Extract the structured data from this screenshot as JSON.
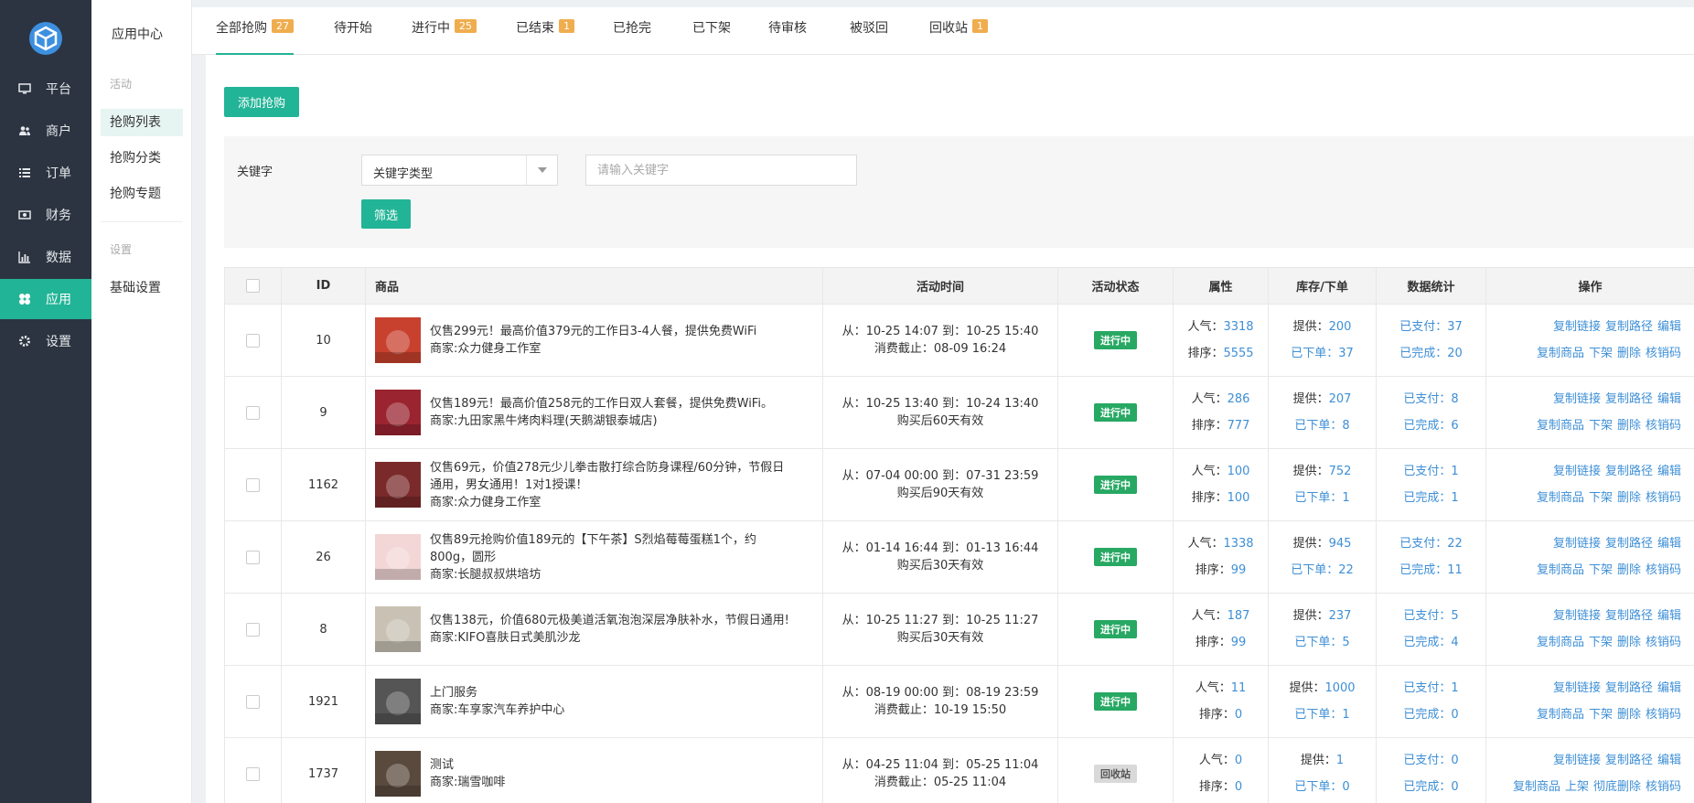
{
  "sidebar": {
    "items": [
      {
        "label": "平台",
        "icon": "monitor-icon"
      },
      {
        "label": "商户",
        "icon": "users-icon"
      },
      {
        "label": "订单",
        "icon": "list-icon"
      },
      {
        "label": "财务",
        "icon": "money-icon"
      },
      {
        "label": "数据",
        "icon": "bar-chart-icon"
      },
      {
        "label": "应用",
        "icon": "apps-icon"
      },
      {
        "label": "设置",
        "icon": "gear-icon"
      }
    ],
    "active": "应用"
  },
  "subnav": {
    "title": "应用中心",
    "section1": "活动",
    "items1": [
      "抢购列表",
      "抢购分类",
      "抢购专题"
    ],
    "section2": "设置",
    "items2": [
      "基础设置"
    ]
  },
  "tabs": [
    {
      "label": "全部抢购",
      "badge": "27"
    },
    {
      "label": "待开始",
      "badge": ""
    },
    {
      "label": "进行中",
      "badge": "25"
    },
    {
      "label": "已结束",
      "badge": "1"
    },
    {
      "label": "已抢完",
      "badge": ""
    },
    {
      "label": "已下架",
      "badge": ""
    },
    {
      "label": "待审核",
      "badge": ""
    },
    {
      "label": "被驳回",
      "badge": ""
    },
    {
      "label": "回收站",
      "badge": "1"
    }
  ],
  "toolbar": {
    "add_label": "添加抢购"
  },
  "filter": {
    "label": "关键字",
    "select_value": "关键字类型",
    "input_placeholder": "请输入关键字",
    "submit_label": "筛选"
  },
  "table": {
    "headers": [
      "ID",
      "商品",
      "活动时间",
      "活动状态",
      "属性",
      "库存/下单",
      "数据统计",
      "操作"
    ],
    "rows": [
      {
        "id": "10",
        "title": "仅售299元！最高价值379元的工作日3-4人餐，提供免费WiFi",
        "merchant": "商家:众力健身工作室",
        "time1": "从：10-25 14:07 到：10-25 15:40",
        "time2": "消费截止：08-09 16:24",
        "status": "进行中",
        "pop_label": "人气：",
        "pop": "3318",
        "sort_label": "排序：",
        "sort": "5555",
        "supply_label": "提供：",
        "supply": "200",
        "ordered_label": "已下单：",
        "ordered": "37",
        "paid_label": "已支付：",
        "paid": "37",
        "done_label": "已完成：",
        "done": "20",
        "ops1": [
          "复制链接",
          "复制路径",
          "编辑"
        ],
        "ops2": [
          "复制商品",
          "下架",
          "删除",
          "核销码"
        ],
        "thumb_color": "#c8412e"
      },
      {
        "id": "9",
        "title": "仅售189元！最高价值258元的工作日双人套餐，提供免费WiFi。",
        "merchant": "商家:九田家黑牛烤肉料理(天鹅湖银泰城店)",
        "time1": "从：10-25 13:40 到：10-24 13:40",
        "time2": "购买后60天有效",
        "status": "进行中",
        "pop_label": "人气：",
        "pop": "286",
        "sort_label": "排序：",
        "sort": "777",
        "supply_label": "提供：",
        "supply": "207",
        "ordered_label": "已下单：",
        "ordered": "8",
        "paid_label": "已支付：",
        "paid": "8",
        "done_label": "已完成：",
        "done": "6",
        "ops1": [
          "复制链接",
          "复制路径",
          "编辑"
        ],
        "ops2": [
          "复制商品",
          "下架",
          "删除",
          "核销码"
        ],
        "thumb_color": "#9a2430"
      },
      {
        "id": "1162",
        "title": "仅售69元，价值278元少儿拳击散打综合防身课程/60分钟，节假日通用，男女通用！1对1授课！",
        "merchant": "商家:众力健身工作室",
        "time1": "从：07-04 00:00 到：07-31 23:59",
        "time2": "购买后90天有效",
        "status": "进行中",
        "pop_label": "人气：",
        "pop": "100",
        "sort_label": "排序：",
        "sort": "100",
        "supply_label": "提供：",
        "supply": "752",
        "ordered_label": "已下单：",
        "ordered": "1",
        "paid_label": "已支付：",
        "paid": "1",
        "done_label": "已完成：",
        "done": "1",
        "ops1": [
          "复制链接",
          "复制路径",
          "编辑"
        ],
        "ops2": [
          "复制商品",
          "下架",
          "删除",
          "核销码"
        ],
        "thumb_color": "#7a2a2a"
      },
      {
        "id": "26",
        "title": "仅售89元抢购价值189元的【下午茶】S烈焰莓莓蛋糕1个，约800g，圆形",
        "merchant": "商家:长腿叔叔烘培坊",
        "time1": "从：01-14 16:44 到：01-13 16:44",
        "time2": "购买后30天有效",
        "status": "进行中",
        "pop_label": "人气：",
        "pop": "1338",
        "sort_label": "排序：",
        "sort": "99",
        "supply_label": "提供：",
        "supply": "945",
        "ordered_label": "已下单：",
        "ordered": "22",
        "paid_label": "已支付：",
        "paid": "22",
        "done_label": "已完成：",
        "done": "11",
        "ops1": [
          "复制链接",
          "复制路径",
          "编辑"
        ],
        "ops2": [
          "复制商品",
          "下架",
          "删除",
          "核销码"
        ],
        "thumb_color": "#f3d6d6"
      },
      {
        "id": "8",
        "title": "仅售138元，价值680元极美道活氧泡泡深层净肤补水，节假日通用!",
        "merchant": "商家:KIFO喜肤日式美肌沙龙",
        "time1": "从：10-25 11:27 到：10-25 11:27",
        "time2": "购买后30天有效",
        "status": "进行中",
        "pop_label": "人气：",
        "pop": "187",
        "sort_label": "排序：",
        "sort": "99",
        "supply_label": "提供：",
        "supply": "237",
        "ordered_label": "已下单：",
        "ordered": "5",
        "paid_label": "已支付：",
        "paid": "5",
        "done_label": "已完成：",
        "done": "4",
        "ops1": [
          "复制链接",
          "复制路径",
          "编辑"
        ],
        "ops2": [
          "复制商品",
          "下架",
          "删除",
          "核销码"
        ],
        "thumb_color": "#c9c2b4"
      },
      {
        "id": "1921",
        "title": "上门服务",
        "merchant": "商家:车享家汽车养护中心",
        "time1": "从：08-19 00:00 到：08-19 23:59",
        "time2": "消费截止：10-19 15:50",
        "status": "进行中",
        "pop_label": "人气：",
        "pop": "11",
        "sort_label": "排序：",
        "sort": "0",
        "supply_label": "提供：",
        "supply": "1000",
        "ordered_label": "已下单：",
        "ordered": "1",
        "paid_label": "已支付：",
        "paid": "1",
        "done_label": "已完成：",
        "done": "0",
        "ops1": [
          "复制链接",
          "复制路径",
          "编辑"
        ],
        "ops2": [
          "复制商品",
          "下架",
          "删除",
          "核销码"
        ],
        "thumb_color": "#555555"
      },
      {
        "id": "1737",
        "title": "测试",
        "merchant": "商家:瑞雪咖啡",
        "time1": "从：04-25 11:04 到：05-25 11:04",
        "time2": "消费截止：05-25 11:04",
        "status": "回收站",
        "pop_label": "人气：",
        "pop": "0",
        "sort_label": "排序：",
        "sort": "0",
        "supply_label": "提供：",
        "supply": "1",
        "ordered_label": "已下单：",
        "ordered": "0",
        "paid_label": "已支付：",
        "paid": "0",
        "done_label": "已完成：",
        "done": "0",
        "ops1": [
          "复制链接",
          "复制路径",
          "编辑"
        ],
        "ops2": [
          "复制商品",
          "上架",
          "彻底删除",
          "核销码"
        ],
        "thumb_color": "#5a4a3e"
      }
    ]
  }
}
